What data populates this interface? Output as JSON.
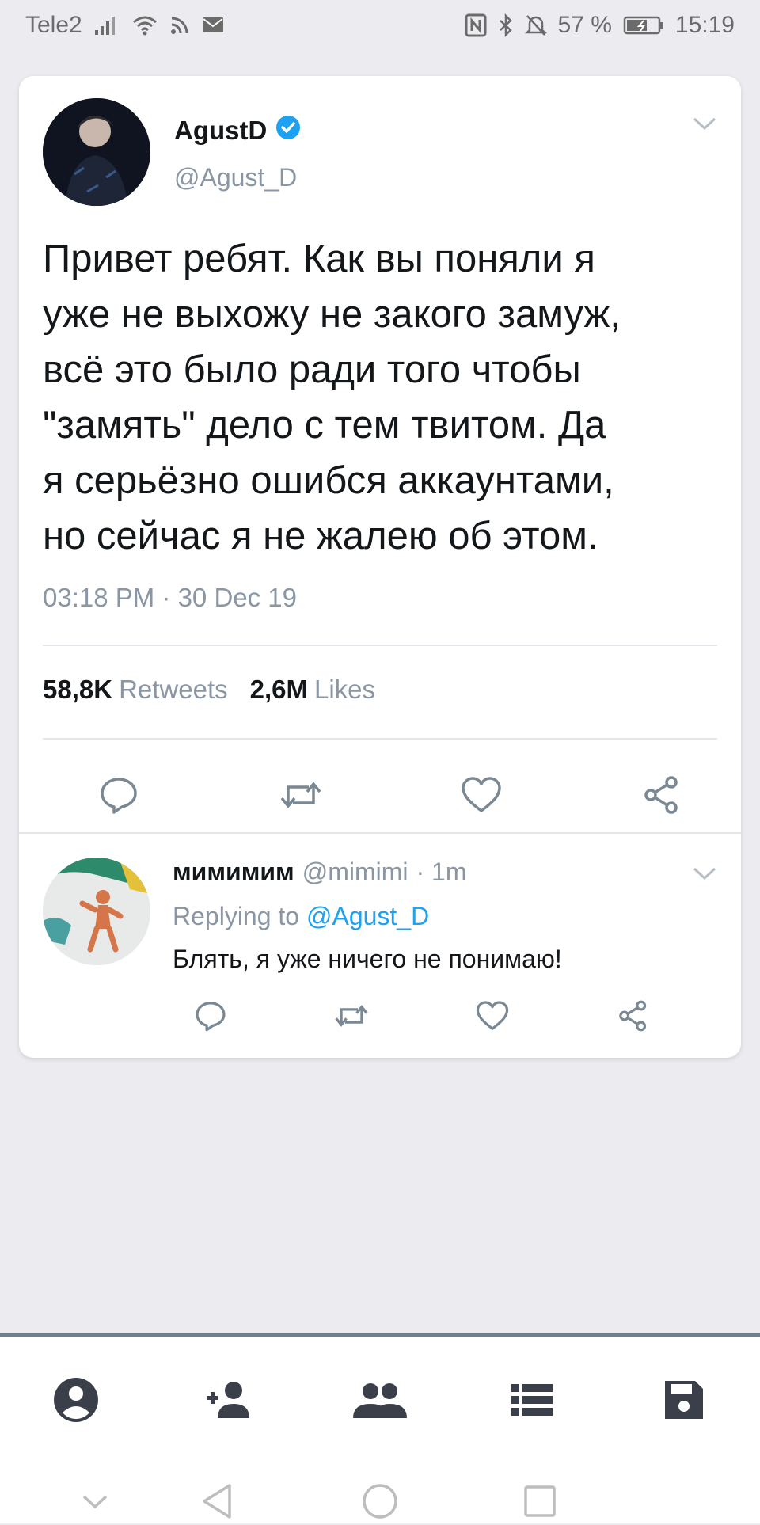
{
  "status_bar": {
    "carrier": "Tele2",
    "battery": "57 %",
    "time": "15:19"
  },
  "tweet": {
    "author_name": "AgustD",
    "author_handle": "@Agust_D",
    "verified": true,
    "text": "Привет ребят. Как вы поняли я\nуже не выхожу не закого замуж,\nвсё это было ради того чтобы\n\"замять\" дело с тем твитом. Да\nя серьёзно ошибся аккаунтами,\nно сейчас я не жалею об этом.",
    "timestamp": "03:18 PM · 30 Dec 19",
    "retweets_count": "58,8K",
    "retweets_label": "Retweets",
    "likes_count": "2,6M",
    "likes_label": "Likes"
  },
  "reply": {
    "name": "мимимим",
    "handle": "@mimimi",
    "time": "· 1m",
    "replying_prefix": "Replying to",
    "replying_handle": "@Agust_D",
    "text": "Блять, я уже ничего не понимаю!"
  },
  "icons": {
    "reply": "reply-icon",
    "retweet": "retweet-icon",
    "like": "heart-icon",
    "share": "share-icon",
    "nav": [
      "account-circle-icon",
      "person-add-icon",
      "group-icon",
      "list-icon",
      "save-icon"
    ],
    "system": [
      "chevron-down-icon",
      "back-icon",
      "home-icon",
      "recents-icon"
    ]
  },
  "colors": {
    "background": "#ecebf0",
    "card": "#ffffff",
    "primary_text": "#14171a",
    "secondary_text": "#8a96a3",
    "link": "#1da1f2",
    "verified": "#1da1f2",
    "nav_icon": "#3a3f4a"
  }
}
